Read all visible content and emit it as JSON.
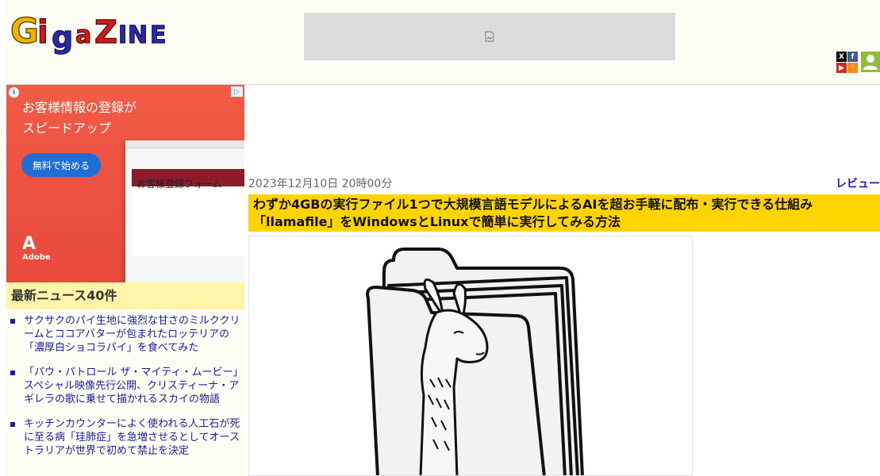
{
  "site": {
    "logo_text": "GIGAZINE",
    "colors": {
      "logo_g": "#f0b300",
      "logo_i": "#cc1b1b",
      "logo_g2": "#2a2aa8",
      "logo_a": "#d81b1b",
      "logo_z": "#cc1b1b",
      "logo_ine": "#2a2aa8"
    }
  },
  "header": {
    "social_icons": [
      "x-icon",
      "facebook-icon",
      "youtube-icon",
      "rss-icon"
    ],
    "member_icon": "person-icon"
  },
  "side_ad": {
    "headline_line1": "お客様情報の登録が",
    "headline_line2": "スピードアップ",
    "cta_label": "無料で始める",
    "form_title": "お客様登録フォーム",
    "brand": "Adobe",
    "info_glyph": "i",
    "choice_glyph": "▷"
  },
  "news": {
    "heading": "最新ニュース40件",
    "items": [
      {
        "title": "サクサクのパイ生地に強烈な甘さのミルククリームとココアバターが包まれたロッテリアの「濃厚白ショコラパイ」を食べてみた"
      },
      {
        "title": "「パウ・パトロール ザ・マイティ・ムービー」スペシャル映像先行公開、クリスティーナ・アギレラの歌に乗せて描かれるスカイの物語"
      },
      {
        "title": "キッチンカウンターによく使われる人工石が死に至る病「珪肺症」を急増させるとしてオーストラリアが世界で初めて禁止を決定"
      }
    ]
  },
  "article": {
    "date": "2023年12月10日 20時00分",
    "category": "レビュー",
    "title": "わずか4GBの実行ファイル1つで大規模言語モデルによるAIを超お手軽に配布・実行できる仕組み「llamafile」をWindowsとLinuxで簡単に実行してみる方法"
  }
}
